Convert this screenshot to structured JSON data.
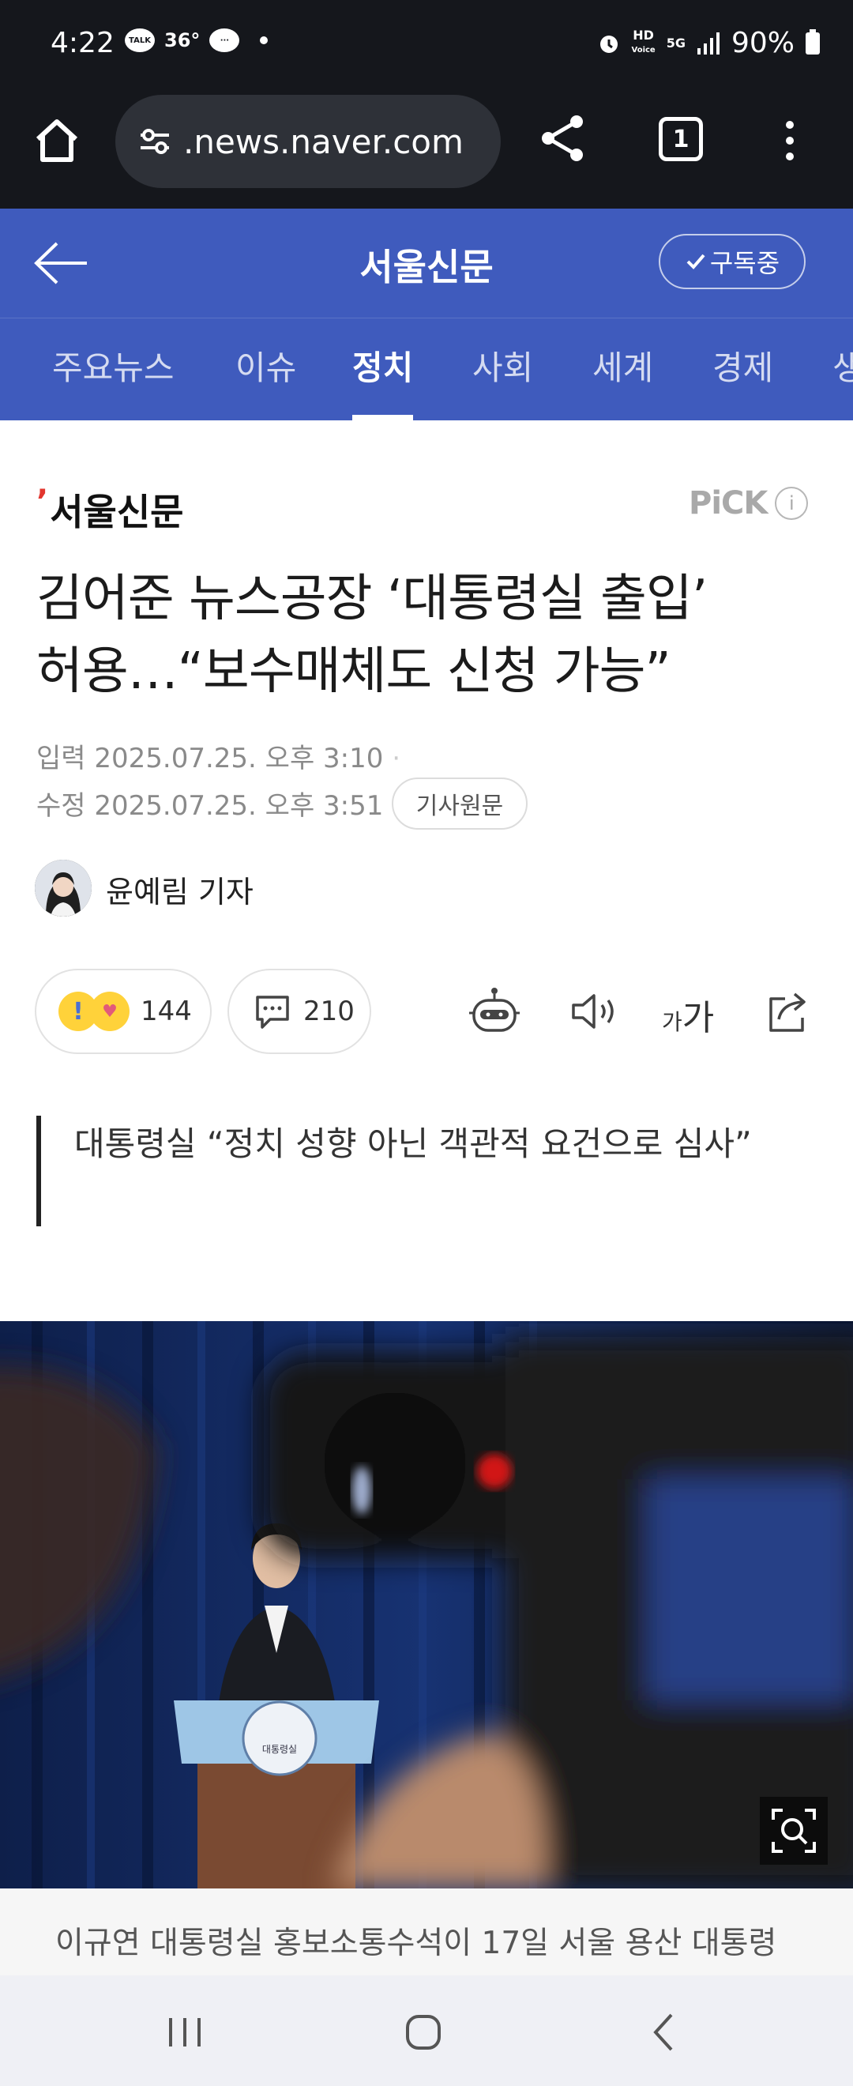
{
  "status_bar": {
    "time": "4:22",
    "talk_label": "TALK",
    "temperature": "36°",
    "network_hd": "HD",
    "network_voice": "Voice",
    "network_5g": "5G",
    "battery": "90%"
  },
  "browser": {
    "url": ".news.naver.com",
    "tab_count": "1"
  },
  "header": {
    "title": "서울신문",
    "subscribe_label": "구독중"
  },
  "section_tabs": [
    {
      "label": "주요뉴스",
      "active": false
    },
    {
      "label": "이슈",
      "active": false
    },
    {
      "label": "정치",
      "active": true
    },
    {
      "label": "사회",
      "active": false
    },
    {
      "label": "세계",
      "active": false
    },
    {
      "label": "경제",
      "active": false
    },
    {
      "label": "생",
      "active": false
    }
  ],
  "article": {
    "press_name": "서울신문",
    "pick_label": "PiCK",
    "headline_line1": "김어준 뉴스공장 ‘대통령실 출입’",
    "headline_line2": "허용…“보수매체도 신청 가능”",
    "input_label": "입력",
    "input_date": "2025.07.25. 오후 3:10",
    "modified_label": "수정",
    "modified_date": "2025.07.25. 오후 3:51",
    "source_button": "기사원문",
    "reporter": "윤예림 기자",
    "reaction_count": "144",
    "comment_count": "210",
    "font_size_small": "가",
    "font_size_large": "가",
    "summary": "대통령실 “정치 성향 아닌 객관적 요건으로 심사”",
    "podium_label": "대통령실",
    "caption": "이규연 대통령실 홍보소통수석이 17일 서울 용산 대통령"
  },
  "colors": {
    "header_blue": "#3f5bbd",
    "browser_dark": "#15171c",
    "press_red": "#e2362e"
  }
}
